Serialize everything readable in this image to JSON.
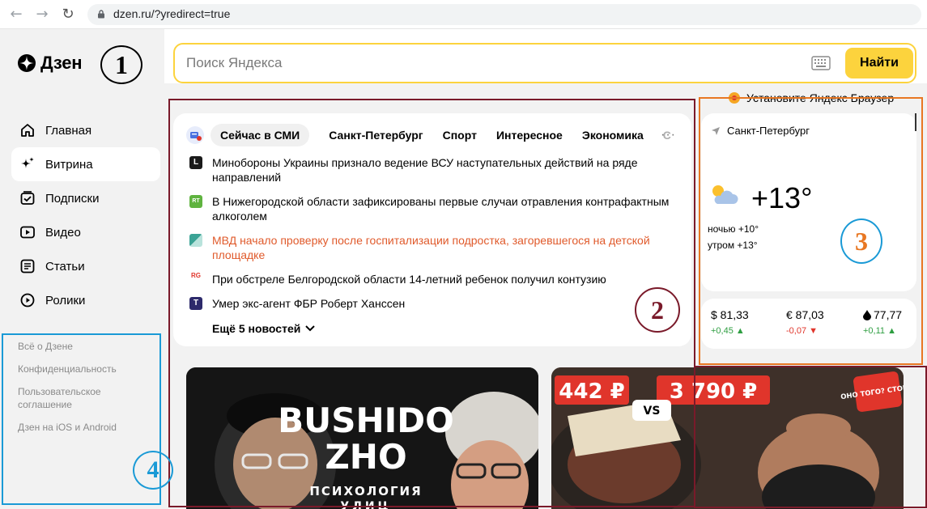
{
  "browser": {
    "url": "dzen.ru/?yredirect=true"
  },
  "sidebar": {
    "logo_text": "Дзен",
    "items": [
      {
        "label": "Главная",
        "icon": "home-icon"
      },
      {
        "label": "Витрина",
        "icon": "sparkle-icon",
        "active": true
      },
      {
        "label": "Подписки",
        "icon": "subscriptions-icon"
      },
      {
        "label": "Видео",
        "icon": "video-icon"
      },
      {
        "label": "Статьи",
        "icon": "articles-icon"
      },
      {
        "label": "Ролики",
        "icon": "shorts-icon"
      }
    ],
    "footer_links": [
      "Всё о Дзене",
      "Конфиденциальность",
      "Пользовательское соглашение",
      "Дзен на iOS и Android"
    ]
  },
  "search": {
    "placeholder": "Поиск Яндекса",
    "button_label": "Найти"
  },
  "promo": {
    "browser_text": "Установите Яндекс Браузер"
  },
  "news": {
    "tabs": [
      "Сейчас в СМИ",
      "Санкт-Петербург",
      "Спорт",
      "Интересное",
      "Экономика",
      "С"
    ],
    "items": [
      {
        "source_icon": "L",
        "color": "#1a1a1a",
        "text": "Минобороны Украины признало ведение ВСУ наступательных действий на ряде направлений",
        "highlight": false
      },
      {
        "source_icon": "RT",
        "color": "#5fb33f",
        "text": "В Нижегородской области зафиксированы первые случаи отравления контрафактным алкоголем",
        "highlight": false
      },
      {
        "source_icon": "",
        "color": "#3aa395",
        "text": "МВД начало проверку после госпитализации подростка, загоревшегося на детской площадке",
        "highlight": true
      },
      {
        "source_icon": "RG",
        "color": "#e0352b",
        "text": "При обстреле Белгородской области 14-летний ребенок получил контузию",
        "highlight": false
      },
      {
        "source_icon": "T",
        "color": "#2d2a6b",
        "text": "Умер экс-агент ФБР Роберт Ханссен",
        "highlight": false
      }
    ],
    "more_label": "Ещё 5 новостей"
  },
  "weather": {
    "city": "Санкт-Петербург",
    "temp": "+13°",
    "night": "ночью +10°",
    "morning": "утром +13°"
  },
  "rates": [
    {
      "value": "$ 81,33",
      "change": "+0,45 ▲",
      "dir": "up"
    },
    {
      "value": "€ 87,03",
      "change": "-0,07 ▼",
      "dir": "down"
    },
    {
      "value": "77,77",
      "change": "+0,11 ▲",
      "dir": "up"
    }
  ],
  "videos": [
    {
      "title_line1": "BUSHIDO",
      "title_line2": "ZHO",
      "subtitle": "ПСИХОЛОГИЯ",
      "subtitle2": "УЛИЦ"
    },
    {
      "price1": "442 ₽",
      "price2": "3 790 ₽",
      "vs": "VS",
      "sticker": "ОНО ТОГО? СТОИТ"
    }
  ],
  "annotations": [
    {
      "label": "1",
      "color": "#000000"
    },
    {
      "label": "2",
      "color": "#7a1a2a"
    },
    {
      "label": "3",
      "color": "#e87722"
    },
    {
      "label": "4",
      "color": "#1a9ad6"
    }
  ]
}
